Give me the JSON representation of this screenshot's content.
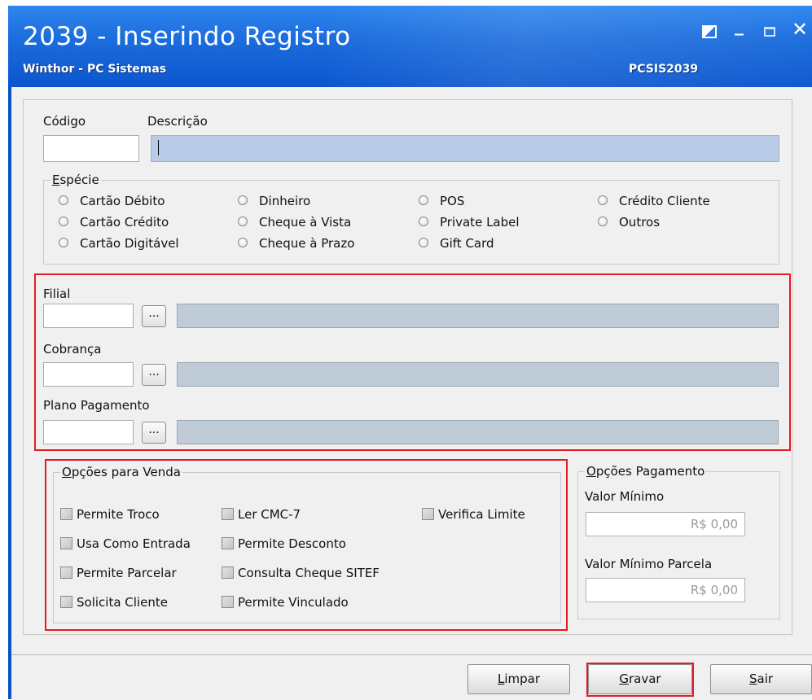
{
  "window": {
    "title": "2039 - Inserindo Registro",
    "subtitle": "Winthor - PC Sistemas",
    "code": "PCSIS2039"
  },
  "form": {
    "codigo_label": "Código",
    "codigo_value": "",
    "descricao_label": "Descrição",
    "descricao_value": ""
  },
  "especie": {
    "legend_first": "E",
    "legend_rest": "spécie",
    "options": [
      "Cartão Débito",
      "Cartão Crédito",
      "Cartão Digitável",
      "Dinheiro",
      "Cheque à Vista",
      "Cheque à Prazo",
      "POS",
      "Private Label",
      "Gift Card",
      "Crédito Cliente",
      "Outros"
    ],
    "selected": null
  },
  "lookups": {
    "filial_label": "Filial",
    "cobranca_label": "Cobrança",
    "plano_label": "Plano Pagamento",
    "browse_label": "..."
  },
  "opcoes_venda": {
    "legend_first": "O",
    "legend_rest": "pções para Venda",
    "items": [
      "Permite Troco",
      "Usa Como Entrada",
      "Permite Parcelar",
      "Solicita Cliente",
      "Ler CMC-7",
      "Permite Desconto",
      "Consulta Cheque SITEF",
      "Permite Vinculado",
      "Verifica Limite"
    ],
    "checked": []
  },
  "opcoes_pagamento": {
    "legend_first": "O",
    "legend_rest": "pções Pagamento",
    "valor_minimo_label": "Valor Mínimo",
    "valor_minimo_value": "R$ 0,00",
    "valor_minimo_parcela_label": "Valor Mínimo Parcela",
    "valor_minimo_parcela_value": "R$ 0,00"
  },
  "buttons": {
    "limpar_first": "L",
    "limpar_rest": "impar",
    "gravar_first": "G",
    "gravar_rest": "ravar",
    "sair_first": "S",
    "sair_rest": "air"
  },
  "colors": {
    "titlebar": "#1c6ddd",
    "highlight": "#e51b23",
    "readonly_field": "#bfccd8"
  }
}
